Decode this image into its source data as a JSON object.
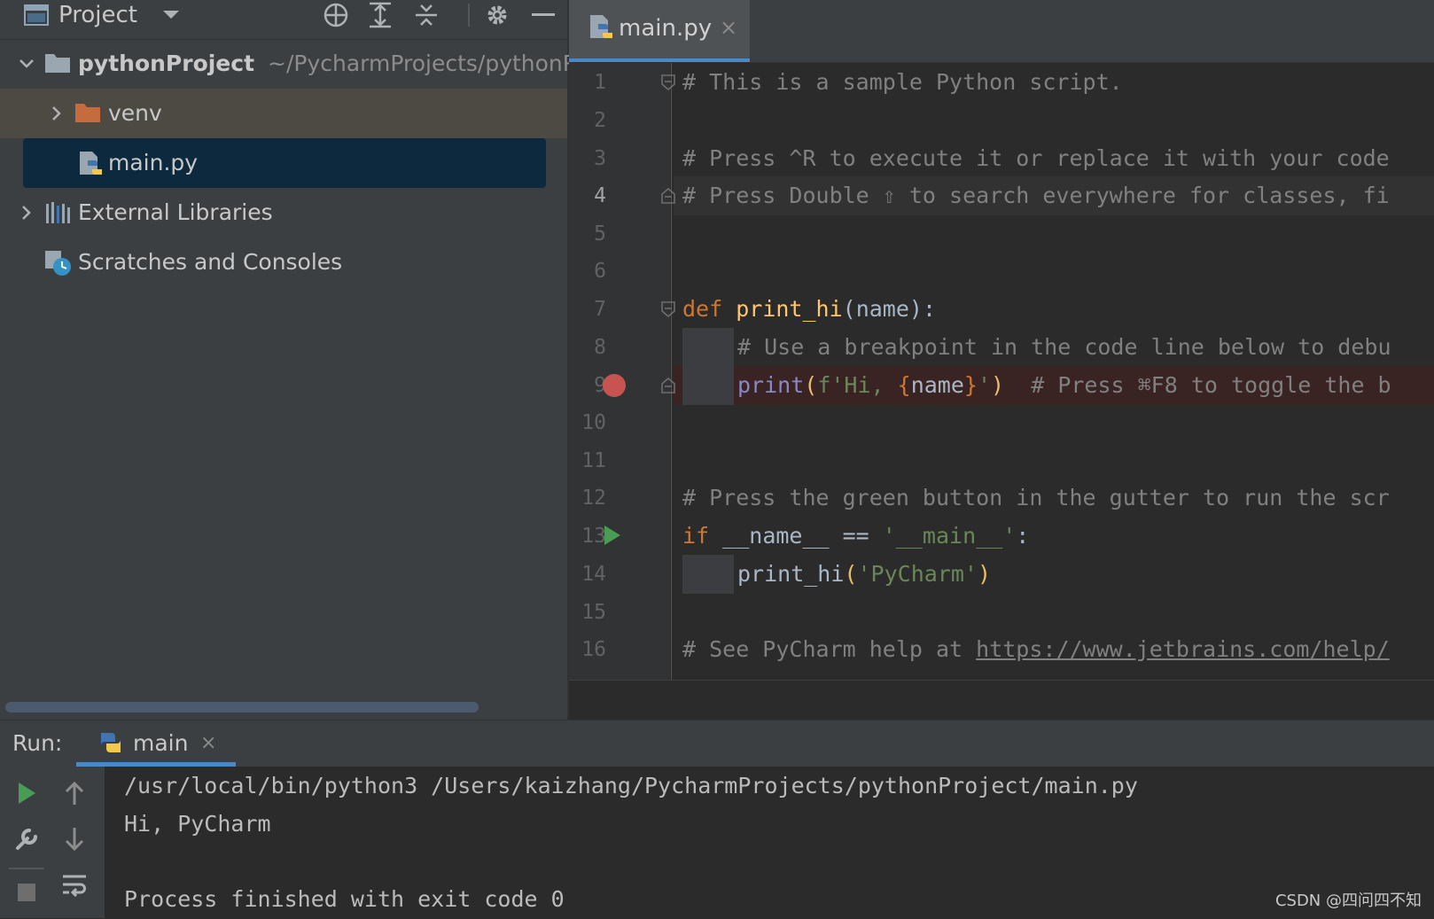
{
  "project_panel": {
    "title": "Project",
    "root": {
      "name": "pythonProject",
      "path": "~/PycharmProjects/pythonProject"
    },
    "items": [
      {
        "label": "venv"
      },
      {
        "label": "main.py"
      },
      {
        "label": "External Libraries"
      },
      {
        "label": "Scratches and Consoles"
      }
    ]
  },
  "editor": {
    "tab": {
      "label": "main.py",
      "close": "×"
    },
    "lines": [
      {
        "n": "1",
        "text": "# This is a sample Python script."
      },
      {
        "n": "2",
        "text": ""
      },
      {
        "n": "3",
        "text": "# Press ^R to execute it or replace it with your code"
      },
      {
        "n": "4",
        "text": "# Press Double ⇧ to search everywhere for classes, fi"
      },
      {
        "n": "5",
        "text": ""
      },
      {
        "n": "6",
        "text": ""
      },
      {
        "n": "7",
        "kw": "def",
        "fn": "print_hi",
        "params": "name",
        "tail": "):"
      },
      {
        "n": "8",
        "text": "# Use a breakpoint in the code line below to debu"
      },
      {
        "n": "9",
        "builtin": "print",
        "fstr_a": "f'Hi, ",
        "fvar": "name",
        "fstr_b": "'",
        "comment": "# Press ⌘F8 to toggle the b"
      },
      {
        "n": "10",
        "text": ""
      },
      {
        "n": "11",
        "text": ""
      },
      {
        "n": "12",
        "text": "# Press the green button in the gutter to run the scr"
      },
      {
        "n": "13",
        "kw": "if",
        "rest": " __name__ == ",
        "str": "'__main__'",
        "tail": ":"
      },
      {
        "n": "14",
        "fn": "print_hi",
        "str": "'PyCharm'"
      },
      {
        "n": "15",
        "text": ""
      },
      {
        "n": "16",
        "text": "# See PyCharm help at ",
        "link": "https://www.jetbrains.com/help/"
      }
    ]
  },
  "run_panel": {
    "label": "Run:",
    "tab": {
      "label": "main",
      "close": "×"
    },
    "console": [
      "/usr/local/bin/python3 /Users/kaizhang/PycharmProjects/pythonProject/main.py",
      "Hi, PyCharm",
      "",
      "Process finished with exit code 0"
    ]
  },
  "watermark": "CSDN @四问四不知",
  "colors": {
    "accent": "#4a88c7",
    "breakpoint": "#c75450",
    "run": "#499c54",
    "keyword": "#cc7832",
    "function": "#ffc66d",
    "string": "#6a8759",
    "comment": "#808080"
  }
}
